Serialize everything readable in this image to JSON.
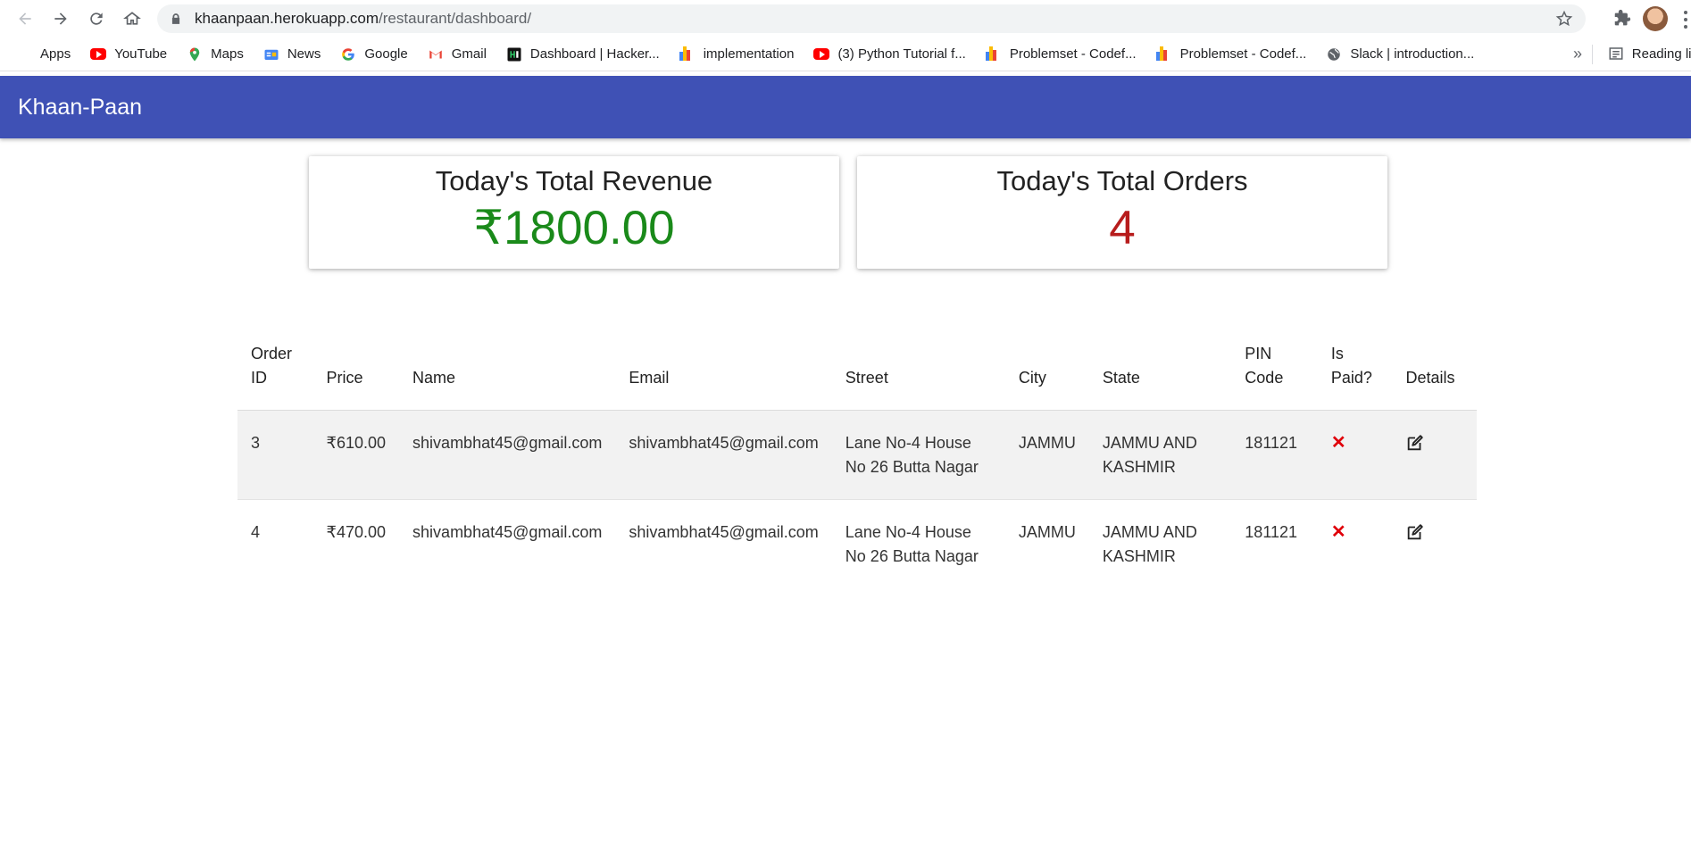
{
  "browser": {
    "url_host": "khaanpaan.herokuapp.com",
    "url_path": "/restaurant/dashboard/",
    "bookmarks": [
      {
        "label": "Apps",
        "icon": "apps-grid-icon"
      },
      {
        "label": "YouTube",
        "icon": "youtube-icon"
      },
      {
        "label": "Maps",
        "icon": "maps-pin-icon"
      },
      {
        "label": "News",
        "icon": "news-icon"
      },
      {
        "label": "Google",
        "icon": "google-g-icon"
      },
      {
        "label": "Gmail",
        "icon": "gmail-icon"
      },
      {
        "label": "Dashboard | Hacker...",
        "icon": "hackerrank-icon"
      },
      {
        "label": "implementation",
        "icon": "bar-chart-icon"
      },
      {
        "label": "(3) Python Tutorial f...",
        "icon": "youtube-icon"
      },
      {
        "label": "Problemset - Codef...",
        "icon": "bar-chart-icon"
      },
      {
        "label": "Problemset - Codef...",
        "icon": "bar-chart-icon"
      },
      {
        "label": "Slack | introduction...",
        "icon": "globe-icon"
      }
    ],
    "more": "»",
    "reading_list": "Reading lis"
  },
  "app": {
    "brand": "Khaan-Paan"
  },
  "stats": {
    "revenue_title": "Today's Total Revenue",
    "revenue_value": "₹1800.00",
    "revenue_color": "#1a8a1a",
    "orders_title": "Today's Total Orders",
    "orders_value": "4",
    "orders_color": "#b71c1c"
  },
  "table": {
    "headers": [
      "Order ID",
      "Price",
      "Name",
      "Email",
      "Street",
      "City",
      "State",
      "PIN Code",
      "Is Paid?",
      "Details"
    ],
    "headers_split": [
      [
        "Order",
        "ID"
      ],
      [
        "Price"
      ],
      [
        "Name"
      ],
      [
        "Email"
      ],
      [
        "Street"
      ],
      [
        "City"
      ],
      [
        "State"
      ],
      [
        "PIN",
        "Code"
      ],
      [
        "Is",
        "Paid?"
      ],
      [
        "Details"
      ]
    ],
    "rows": [
      {
        "order_id": "3",
        "price": "₹610.00",
        "name": "shivambhat45@gmail.com",
        "email": "shivambhat45@gmail.com",
        "street": "Lane No-4 House No 26 Butta Nagar",
        "city": "JAMMU",
        "state": "JAMMU AND KASHMIR",
        "pin": "181121",
        "paid": "✕",
        "details_icon": "edit-icon"
      },
      {
        "order_id": "4",
        "price": "₹470.00",
        "name": "shivambhat45@gmail.com",
        "email": "shivambhat45@gmail.com",
        "street": "Lane No-4 House No 26 Butta Nagar",
        "city": "JAMMU",
        "state": "JAMMU AND KASHMIR",
        "pin": "181121",
        "paid": "✕",
        "details_icon": "edit-icon"
      }
    ]
  }
}
